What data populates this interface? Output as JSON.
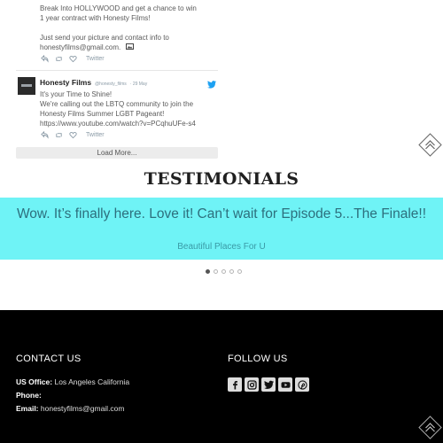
{
  "feed": {
    "tweet1": {
      "line1": "Break Into HOLLYWOOD and get a chance to win",
      "line2": "1 year contract with Honesty Films!",
      "line3": "Just send your picture and contact info to",
      "line4": "honestyfilms@gmail.com.",
      "source": "Twitter"
    },
    "tweet2": {
      "name": "Honesty Films",
      "handle": "@honesty_films",
      "date": "· 29 May",
      "line1": "It's your Time to Shine!",
      "line2": "We're calling out the LBTQ community to join the",
      "line3": "Honesty Films Summer LGBT Pageant!",
      "line4": "https://www.youtube.com/watch?v=PCqhuUFe-s4",
      "source": "Twitter"
    },
    "load_more": "Load More..."
  },
  "testimonials": {
    "title": "TESTIMONIALS",
    "quote": "Wow. It’s finally here. Love it! Can’t wait for Episode 5...The Finale!!",
    "source": "Beautiful Places For U",
    "dots": 5,
    "active_dot": 0
  },
  "footer": {
    "contact_heading": "CONTACT US",
    "office_label": "US Office:",
    "office_value": "Los Angeles California",
    "phone_label": "Phone:",
    "phone_value": "",
    "email_label": "Email:",
    "email_value": "honestyfilms@gmail.com",
    "follow_heading": "FOLLOW US",
    "socials": [
      "facebook-icon",
      "instagram-icon",
      "twitter-icon",
      "youtube-icon",
      "pinterest-icon"
    ]
  },
  "colors": {
    "accent_band": "#6ff3f6",
    "quote_text": "#2d6f7d",
    "footer_bg": "#000000",
    "twitter_blue": "#1da1f2"
  }
}
